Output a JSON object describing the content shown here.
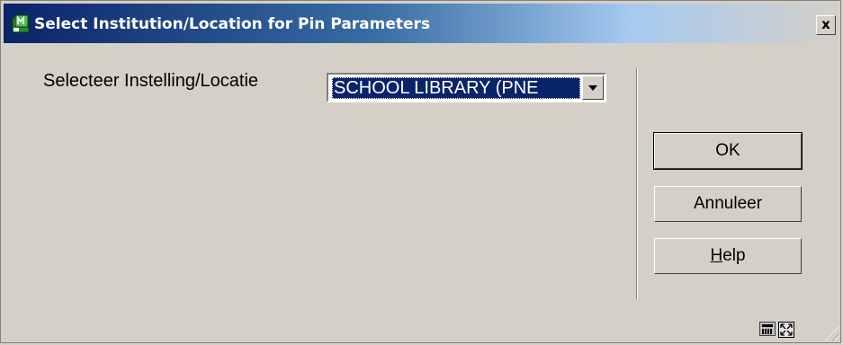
{
  "window": {
    "title": "Select Institution/Location for Pin Parameters",
    "close_label": "x"
  },
  "form": {
    "location_label": "Selecteer Instelling/Locatie",
    "location_selected": "SCHOOL LIBRARY (PNE"
  },
  "buttons": {
    "ok": "OK",
    "cancel": "Annuleer",
    "help": "Help",
    "help_accelerator": "H",
    "help_rest": "elp"
  },
  "status_icons": [
    "calculator-icon",
    "resize-icon"
  ],
  "colors": {
    "titlebar_start": "#0a246a",
    "face": "#d4d0c8",
    "selection": "#0a246a"
  }
}
